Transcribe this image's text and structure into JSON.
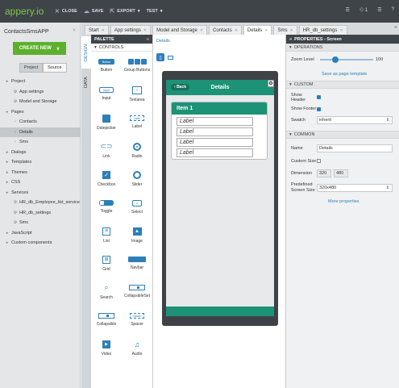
{
  "topbar": {
    "logo": "appery.io",
    "close_label": "CLOSE",
    "save_label": "SAVE",
    "export_label": "EXPORT",
    "test_label": "TEST",
    "users_count": "1"
  },
  "project": {
    "name": "ContactsSmsAPP",
    "create_new_label": "CREATE NEW",
    "tabs": [
      "Project",
      "Source"
    ],
    "tree": [
      {
        "label": "Project",
        "level": 0,
        "icon": "triangle"
      },
      {
        "label": "App settings",
        "level": 1,
        "icon": "gear"
      },
      {
        "label": "Model and Storage",
        "level": 1,
        "icon": "gear"
      },
      {
        "label": "Pages",
        "level": 0,
        "icon": "triangle"
      },
      {
        "label": "Contacts",
        "level": 1,
        "icon": "page"
      },
      {
        "label": "Details",
        "level": 1,
        "icon": "page",
        "selected": true
      },
      {
        "label": "Sms",
        "level": 1,
        "icon": "page"
      },
      {
        "label": "Dialogs",
        "level": 0,
        "icon": "triangle"
      },
      {
        "label": "Templates",
        "level": 0,
        "icon": "triangle"
      },
      {
        "label": "Themes",
        "level": 0,
        "icon": "triangle"
      },
      {
        "label": "CSS",
        "level": 0,
        "icon": "triangle"
      },
      {
        "label": "Services",
        "level": 0,
        "icon": "triangle"
      },
      {
        "label": "HR_db_Employee_list_service",
        "level": 1,
        "icon": "gear"
      },
      {
        "label": "HR_db_settings",
        "level": 1,
        "icon": "gear"
      },
      {
        "label": "Sms",
        "level": 1,
        "icon": "gear"
      },
      {
        "label": "JavaScript",
        "level": 0,
        "icon": "triangle"
      },
      {
        "label": "Custom components",
        "level": 0,
        "icon": "triangle"
      }
    ]
  },
  "editor_tabs": [
    {
      "label": "Start"
    },
    {
      "label": "App settings"
    },
    {
      "label": "Model and Storage"
    },
    {
      "label": "Contacts"
    },
    {
      "label": "Details",
      "active": true
    },
    {
      "label": "Sms"
    },
    {
      "label": "HR_db_settings"
    }
  ],
  "side_tabs": {
    "design": "DESIGN",
    "data": "DATA"
  },
  "palette": {
    "title": "PALETTE",
    "section": "CONTROLS",
    "items": [
      {
        "label": "Button",
        "icon": "button-icon",
        "glyph": "Button"
      },
      {
        "label": "Group Buttons",
        "icon": "group-buttons-icon",
        "glyph": ""
      },
      {
        "label": "Input",
        "icon": "input-icon",
        "glyph": "Input"
      },
      {
        "label": "Textarea",
        "icon": "textarea-icon",
        "glyph": "T"
      },
      {
        "label": "Datepicker",
        "icon": "datepicker-icon",
        "glyph": ""
      },
      {
        "label": "Label",
        "icon": "label-icon",
        "glyph": "Label"
      },
      {
        "label": "Link",
        "icon": "link-icon",
        "glyph": "⊂⊃"
      },
      {
        "label": "Radio",
        "icon": "radio-icon",
        "glyph": ""
      },
      {
        "label": "Checkbox",
        "icon": "checkbox-icon",
        "glyph": "✓"
      },
      {
        "label": "Slider",
        "icon": "slider-icon",
        "glyph": ""
      },
      {
        "label": "Toggle",
        "icon": "toggle-icon",
        "glyph": ""
      },
      {
        "label": "Select",
        "icon": "select-icon",
        "glyph": "⌄"
      },
      {
        "label": "List",
        "icon": "list-icon",
        "glyph": "≡"
      },
      {
        "label": "Image",
        "icon": "image-icon",
        "glyph": "▲"
      },
      {
        "label": "Grid",
        "icon": "grid-icon",
        "glyph": "⊞"
      },
      {
        "label": "Navbar",
        "icon": "navbar-icon",
        "glyph": ""
      },
      {
        "label": "Search",
        "icon": "search-icon",
        "glyph": "⌕"
      },
      {
        "label": "CollapsibleSet",
        "icon": "collapsibleset-icon",
        "glyph": ""
      },
      {
        "label": "Collapsible",
        "icon": "collapsible-icon",
        "glyph": ""
      },
      {
        "label": "Spacer",
        "icon": "spacer-icon",
        "glyph": "Spacer"
      },
      {
        "label": "Video",
        "icon": "video-icon",
        "glyph": "▶"
      },
      {
        "label": "Audio",
        "icon": "audio-icon",
        "glyph": "♫"
      }
    ]
  },
  "canvas": {
    "breadcrumb": "Details",
    "header_title": "Details",
    "back_label": "Back",
    "collapsible_title": "Item 1",
    "labels": [
      "Label",
      "Label",
      "Label",
      "Label"
    ]
  },
  "properties": {
    "title": "PROPERTIES - Screen",
    "operations": {
      "section": "OPERATIONS",
      "zoom_label": "Zoom Level",
      "zoom_value": "100",
      "zoom_fraction": 0.25,
      "save_template": "Save as page template"
    },
    "custom": {
      "section": "CUSTOM",
      "show_header_label": "Show Header",
      "show_header": true,
      "show_footer_label": "Show Footer",
      "show_footer": true,
      "swatch_label": "Swatch",
      "swatch_value": "inherit"
    },
    "common": {
      "section": "COMMON",
      "name_label": "Name",
      "name_value": "Details",
      "custom_size_label": "Custom Size",
      "custom_size": false,
      "dimension_label": "Dimension",
      "width": "320",
      "height": "480",
      "predefined_label": "Predefined Screen Size",
      "predefined_value": "320x480",
      "more_properties": "More properties"
    }
  },
  "colors": {
    "accent": "#2d7fb8",
    "brand_green": "#5cb02b",
    "logo_green": "#7fc64a",
    "header_teal": "#1c9277",
    "topbar": "#3f4448"
  }
}
